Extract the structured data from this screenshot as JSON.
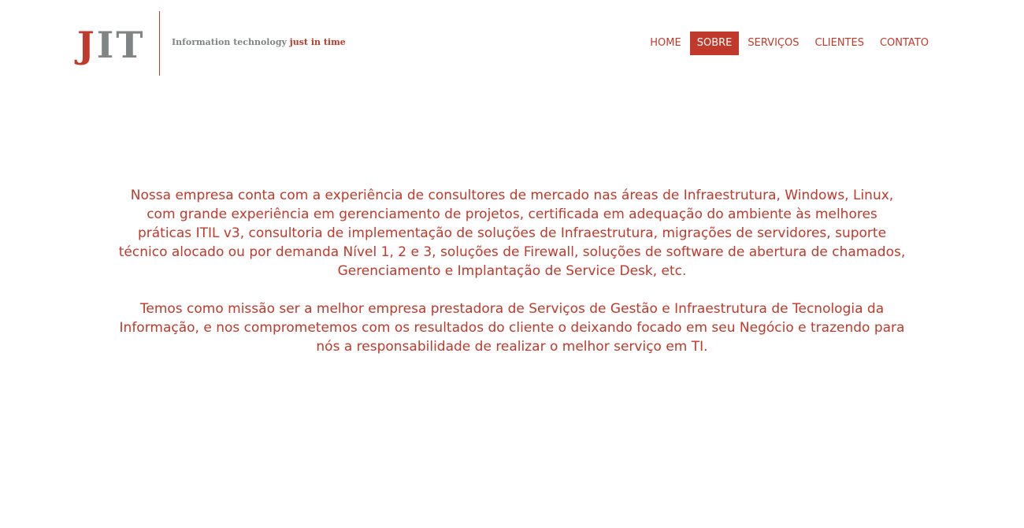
{
  "brand": {
    "logo_j": "J",
    "logo_it": "IT",
    "tagline_plain": "Information technology",
    "tagline_accent": "just in time",
    "colors": {
      "accent": "#c0392b",
      "gray": "#808485"
    }
  },
  "nav": {
    "items": [
      {
        "label": "HOME",
        "active": false
      },
      {
        "label": "SOBRE",
        "active": true
      },
      {
        "label": "SERVIÇOS",
        "active": false
      },
      {
        "label": "CLIENTES",
        "active": false
      },
      {
        "label": "CONTATO",
        "active": false
      }
    ]
  },
  "main": {
    "paragraphs": [
      "Nossa empresa conta com a experiência de consultores de mercado nas áreas de Infraestrutura, Windows, Linux, com grande experiência em gerenciamento de projetos, certificada em adequação do ambiente às melhores práticas ITIL v3, consultoria de implementação de soluções de Infraestrutura, migrações de servidores, suporte técnico alocado ou por demanda Nível 1, 2 e 3, soluções de Firewall, soluções de software de abertura de chamados, Gerenciamento e Implantação de Service Desk, etc.",
      "Temos como missão ser a melhor empresa prestadora de Serviços de Gestão e Infraestrutura de Tecnologia da Informação, e nos comprometemos com os resultados do cliente o deixando focado em seu Negócio e trazendo para nós a responsabilidade de realizar o melhor serviço em TI."
    ]
  }
}
